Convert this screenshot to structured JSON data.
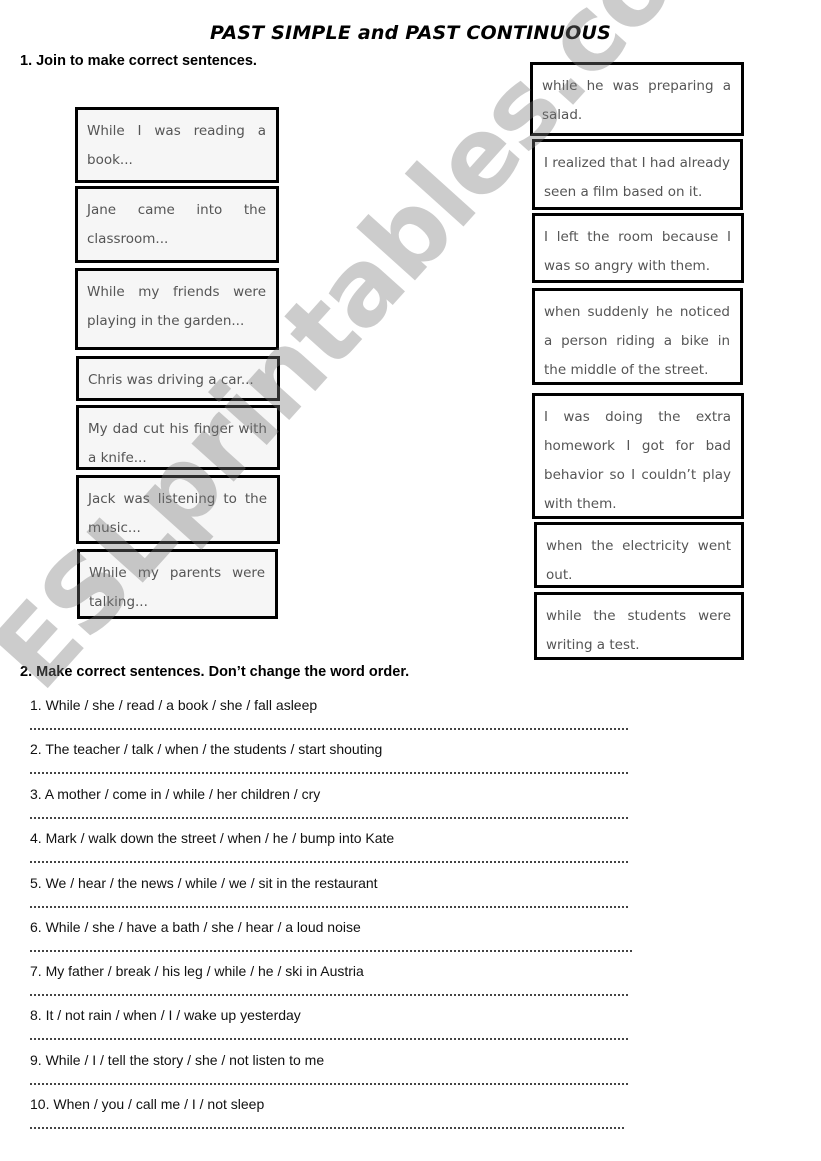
{
  "title": "PAST SIMPLE and PAST CONTINUOUS",
  "section1": {
    "heading": "1. Join to make correct sentences.",
    "left_boxes": [
      "While I was reading a book...",
      "Jane came into the classroom...",
      "While my friends were playing in the garden...",
      "Chris was driving a car...",
      "My dad cut his finger with a knife...",
      "Jack was listening to the music...",
      "While my parents were talking..."
    ],
    "right_boxes": [
      "while he was preparing a salad.",
      "I realized that I had already seen a film based on it.",
      "I left the room because I was so angry with them.",
      "when suddenly he noticed a person riding a bike in the middle of the street.",
      "I was doing the extra homework I got for bad behavior so I couldn’t play with them.",
      "when the electricity went out.",
      "while the students were writing a test."
    ]
  },
  "section2": {
    "heading": "2. Make correct sentences. Don’t change the word order.",
    "items": [
      "1. While / she / read / a book / she / fall asleep",
      "2. The teacher / talk / when / the students / start shouting",
      "3. A mother / come in / while / her children / cry",
      "4. Mark / walk down the street / when / he / bump into Kate",
      "5. We / hear / the news / while / we / sit in the restaurant",
      "6. While / she / have a bath / she / hear / a loud noise",
      "7. My father / break / his leg / while / he / ski in Austria",
      "8. It / not rain / when / I / wake up yesterday",
      "9. While / I / tell the story / she / not listen to me",
      "10. When / you / call me / I / not sleep"
    ]
  },
  "watermark": "ESLprintables.com"
}
